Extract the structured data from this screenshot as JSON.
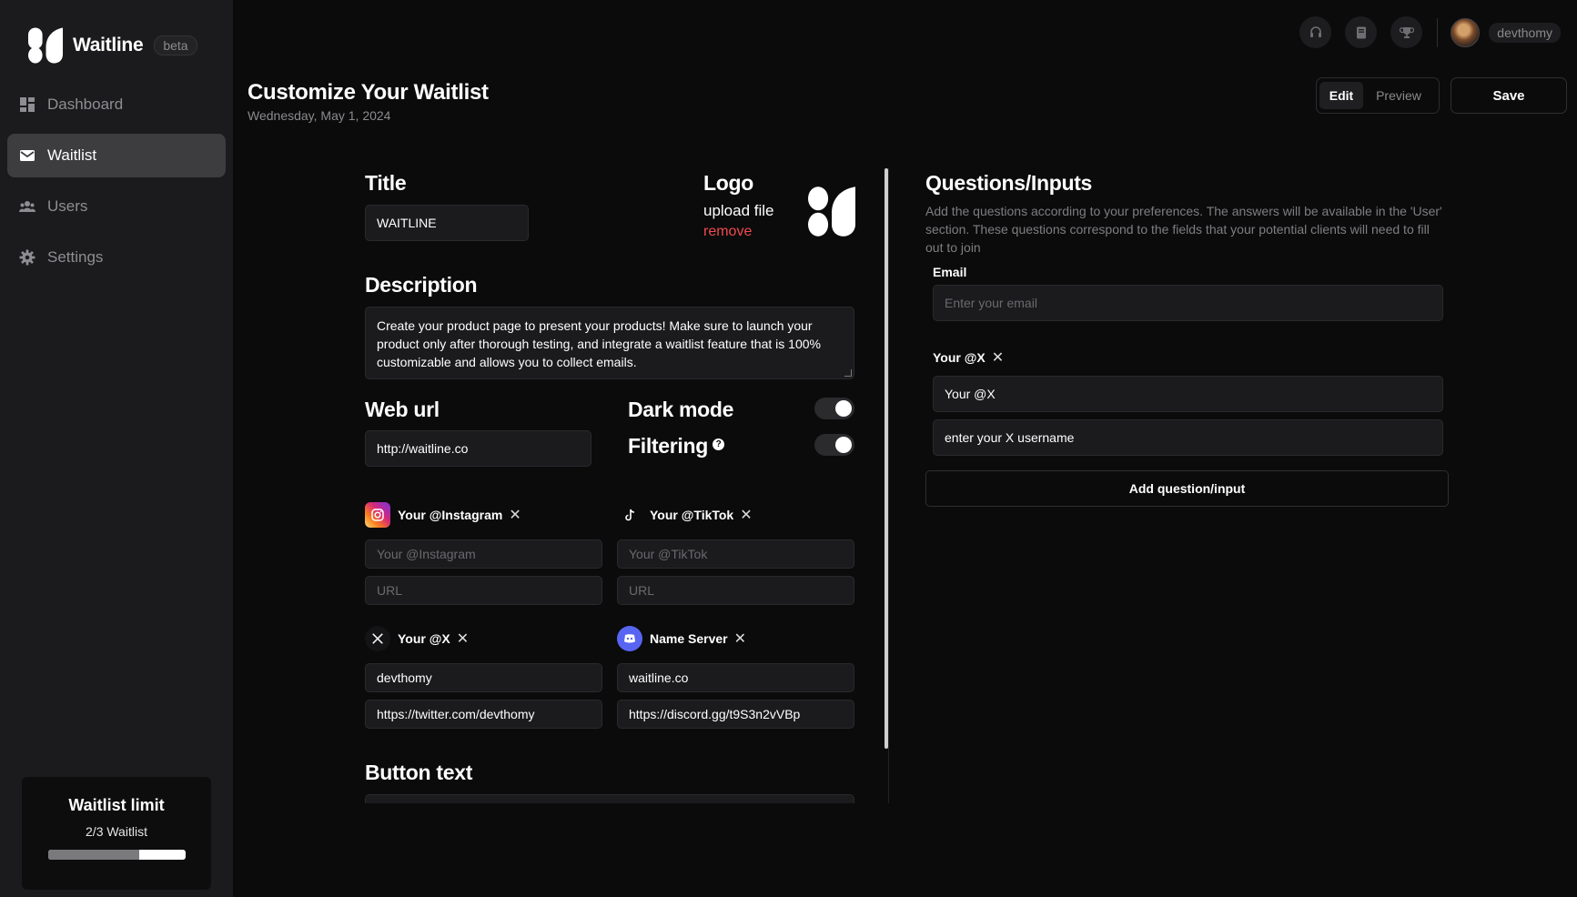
{
  "brand": {
    "name": "Waitline",
    "badge": "beta"
  },
  "sidebar": {
    "items": [
      {
        "label": "Dashboard",
        "icon": "dashboard-icon"
      },
      {
        "label": "Waitlist",
        "icon": "mail-icon",
        "active": true
      },
      {
        "label": "Users",
        "icon": "users-icon"
      },
      {
        "label": "Settings",
        "icon": "gear-icon"
      }
    ],
    "limit": {
      "title": "Waitlist limit",
      "text": "2/3 Waitlist",
      "fraction": 0.667
    }
  },
  "header": {
    "title": "Customize Your Waitlist",
    "date": "Wednesday, May 1, 2024",
    "username": "devthomy",
    "mode_edit": "Edit",
    "mode_preview": "Preview",
    "save_label": "Save"
  },
  "editor": {
    "title_heading": "Title",
    "title_value": "WAITLINE",
    "logo_heading": "Logo",
    "logo_upload": "upload file",
    "logo_remove": "remove",
    "description_heading": "Description",
    "description_value": "Create your product page to present your products! Make sure to launch your product only after thorough testing, and integrate a waitlist feature that is 100% customizable and allows you to collect emails.",
    "weburl_heading": "Web url",
    "weburl_value": "http://waitline.co",
    "darkmode_label": "Dark mode",
    "filtering_label": "Filtering",
    "help_glyph": "?",
    "remove_glyph": "✕",
    "socials": [
      {
        "label": "Your @Instagram",
        "name_placeholder": "Your @Instagram",
        "url_placeholder": "URL",
        "name_value": "",
        "url_value": ""
      },
      {
        "label": "Your @TikTok",
        "name_placeholder": "Your @TikTok",
        "url_placeholder": "URL",
        "name_value": "",
        "url_value": ""
      },
      {
        "label": "Your @X",
        "name_placeholder": "",
        "url_placeholder": "",
        "name_value": "devthomy",
        "url_value": "https://twitter.com/devthomy"
      },
      {
        "label": "Name Server",
        "name_placeholder": "",
        "url_placeholder": "",
        "name_value": "waitline.co",
        "url_value": "https://discord.gg/t9S3n2vVBp"
      }
    ],
    "button_text_heading": "Button text"
  },
  "questions": {
    "heading": "Questions/Inputs",
    "description": "Add the questions according to your preferences. The answers will be available in the 'User' section. These questions correspond to the fields that your potential clients will need to fill out to join",
    "email_label": "Email",
    "email_placeholder": "Enter your email",
    "x_label": "Your @X",
    "x_value": "Your @X",
    "x_placeholder_value": "enter your X username",
    "add_label": "Add question/input"
  },
  "colors": {
    "remove": "#ef4b4b",
    "sidebar_bg": "#1b1b1d",
    "page_bg": "#0b0b0c",
    "instagram": "#d6249f",
    "discord": "#5865f2"
  }
}
